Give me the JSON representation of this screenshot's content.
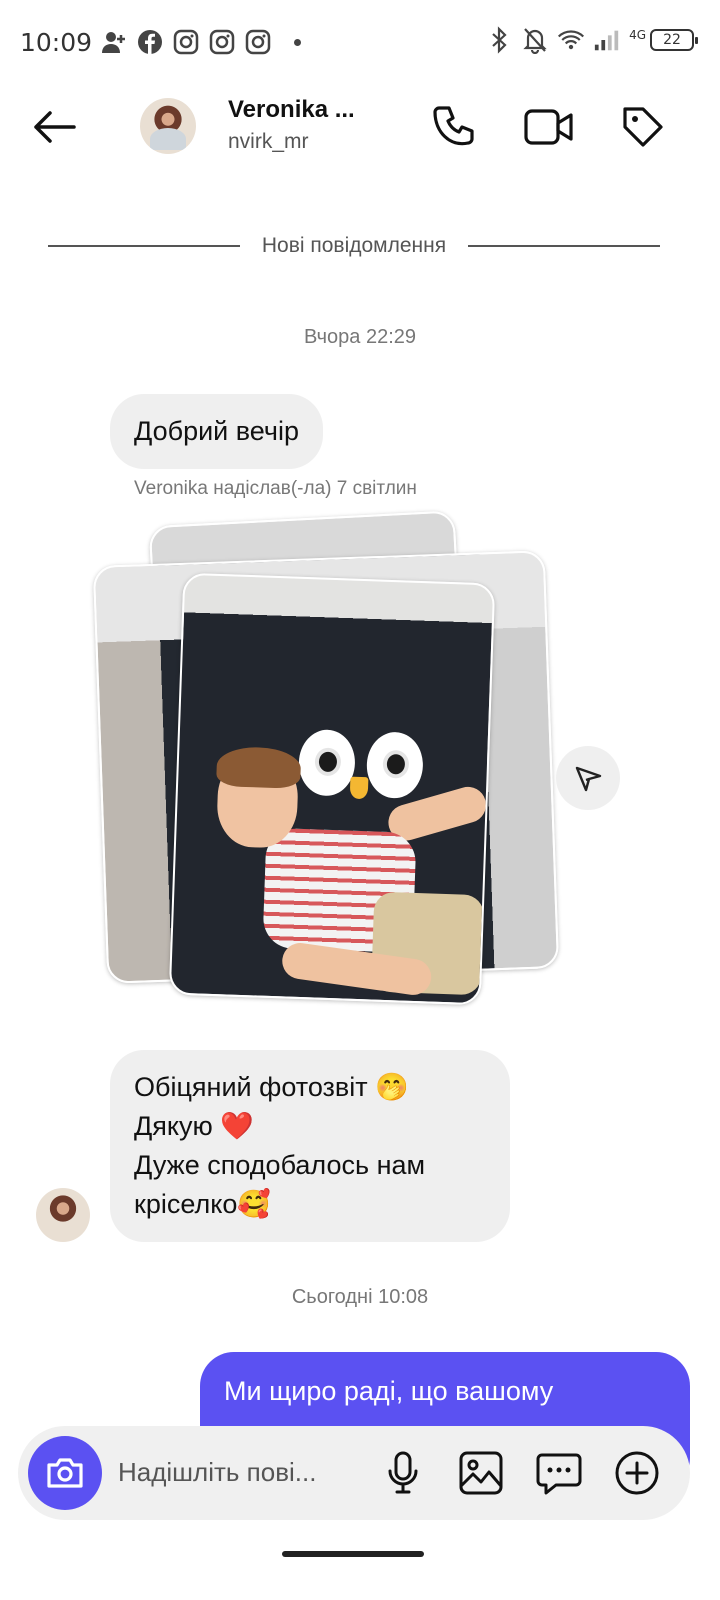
{
  "status_bar": {
    "time": "10:09",
    "left_icons": [
      "person-add-icon",
      "facebook-icon",
      "instagram-icon",
      "instagram-icon",
      "instagram-icon"
    ],
    "right_icons": [
      "bluetooth-icon",
      "bell-off-icon",
      "wifi-icon",
      "signal-icon"
    ],
    "network": "4G",
    "battery": "22"
  },
  "header": {
    "name": "Veronika ...",
    "username": "nvirk_mr",
    "icons": [
      "back-arrow-icon",
      "phone-icon",
      "video-icon",
      "tag-icon"
    ]
  },
  "chat": {
    "new_messages_label": "Нові повідомлення",
    "timestamp_yesterday": "Вчора 22:29",
    "message_1": "Добрий вечір",
    "sent_photos_note": "Veronika надіслав(-ла) 7 світлин",
    "message_2_line_1": "Обіцяний фотозвіт 🤭",
    "message_2_line_2": "Дякую ❤️",
    "message_2_line_3": "Дуже сподобалось нам",
    "message_2_line_4": "кріселко🥰",
    "timestamp_today": "Сьогодні 10:08",
    "outgoing_message_line_1": "Ми щиро раді, що вашому"
  },
  "composer": {
    "placeholder": "Надішліть пові...",
    "icons": [
      "camera-icon",
      "microphone-icon",
      "gallery-icon",
      "sticker-icon",
      "plus-icon"
    ]
  },
  "colors": {
    "accent": "#5b51f2",
    "bubble_incoming": "#efefef",
    "text_secondary": "#777777"
  }
}
